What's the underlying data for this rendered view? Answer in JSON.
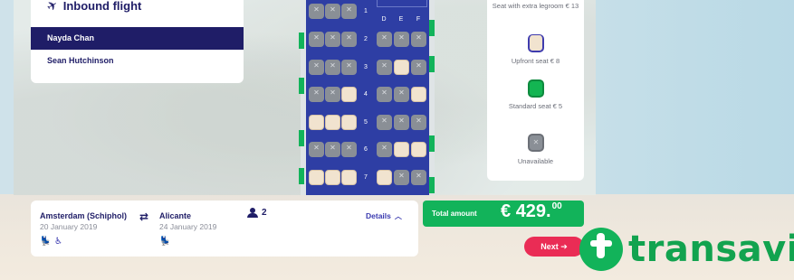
{
  "flight": {
    "title": "Inbound flight",
    "passengers": [
      {
        "name": "Nayda Chan",
        "active": true
      },
      {
        "name": "Sean Hutchinson",
        "active": false
      }
    ]
  },
  "seatmap": {
    "columns_right": [
      "D",
      "E",
      "F"
    ],
    "rows": [
      {
        "number": "1",
        "left": [
          "unavailable",
          "unavailable",
          "unavailable"
        ],
        "right": []
      },
      {
        "number": "2",
        "left": [
          "unavailable",
          "unavailable",
          "unavailable"
        ],
        "right": [
          "unavailable",
          "unavailable",
          "unavailable"
        ]
      },
      {
        "number": "3",
        "left": [
          "unavailable",
          "unavailable",
          "unavailable"
        ],
        "right": [
          "unavailable",
          "upfront",
          "unavailable"
        ]
      },
      {
        "number": "4",
        "left": [
          "unavailable",
          "unavailable",
          "upfront"
        ],
        "right": [
          "unavailable",
          "unavailable",
          "upfront"
        ]
      },
      {
        "number": "5",
        "left": [
          "upfront",
          "upfront",
          "upfront"
        ],
        "right": [
          "unavailable",
          "unavailable",
          "unavailable"
        ]
      },
      {
        "number": "6",
        "left": [
          "unavailable",
          "unavailable",
          "unavailable"
        ],
        "right": [
          "unavailable",
          "upfront",
          "upfront"
        ]
      },
      {
        "number": "7",
        "left": [
          "upfront",
          "upfront",
          "upfront"
        ],
        "right": [
          "upfront",
          "unavailable",
          "unavailable"
        ]
      }
    ]
  },
  "legend": {
    "extra_legroom": "Seat with extra legroom € 13",
    "upfront": "Upfront seat € 8",
    "standard": "Standard seat € 5",
    "unavailable": "Unavailable"
  },
  "trip": {
    "from_city": "Amsterdam (Schiphol)",
    "from_date": "20 January 2019",
    "to_city": "Alicante",
    "to_date": "24 January 2019",
    "passenger_count": "2",
    "details_label": "Details"
  },
  "total": {
    "label": "Total amount",
    "currency": "€",
    "amount_main": "429.",
    "amount_cents": "00"
  },
  "next_label": "Next",
  "logo_text": "transavi",
  "colors": {
    "navy": "#1f1d67",
    "green": "#12b35a",
    "cabin_blue": "#2e3ea4",
    "next_red": "#ea2c55"
  }
}
